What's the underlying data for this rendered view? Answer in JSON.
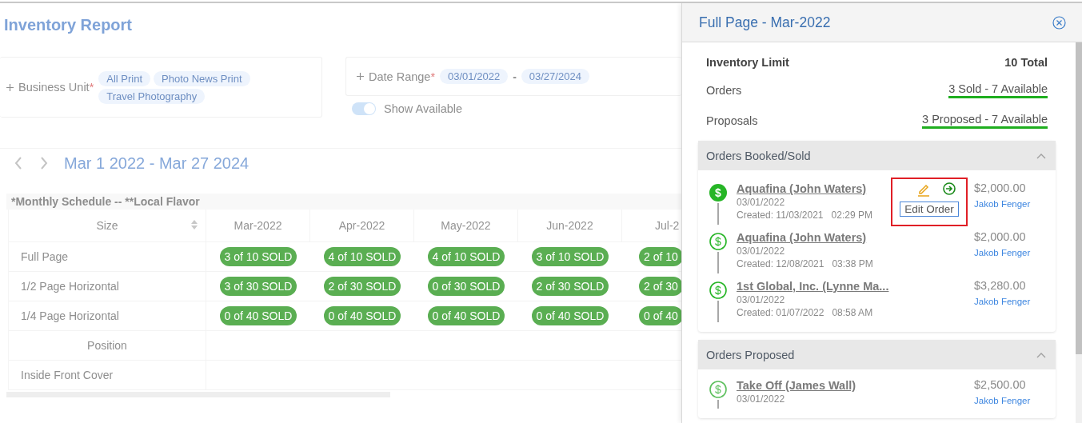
{
  "report": {
    "title": "Inventory Report",
    "business_unit": {
      "label": "Business Unit",
      "required_mark": "*",
      "chips": [
        "All Print",
        "Photo News Print",
        "Travel Photography"
      ]
    },
    "date_range": {
      "label": "Date Range",
      "required_mark": "*",
      "start": "03/01/2022",
      "separator": "-",
      "end": "03/27/2024"
    },
    "show_available": {
      "label": "Show Available",
      "on": true
    },
    "period": "Mar 1 2022 - Mar 27 2024",
    "schedule_title": "*Monthly Schedule -- **Local Flavor",
    "table": {
      "columns": [
        "Size",
        "Mar-2022",
        "Apr-2022",
        "May-2022",
        "Jun-2022",
        "Jul-2"
      ],
      "rows": [
        {
          "kind": "item",
          "cells": [
            "Full Page",
            "3 of 10 SOLD",
            "4 of 10 SOLD",
            "4 of 10 SOLD",
            "3 of 10 SOLD",
            "2 of 10"
          ]
        },
        {
          "kind": "item",
          "cells": [
            "1/2 Page Horizontal",
            "3 of 30 SOLD",
            "2 of 30 SOLD",
            "0 of 30 SOLD",
            "2 of 30 SOLD",
            "2 of 30"
          ]
        },
        {
          "kind": "item",
          "cells": [
            "1/4 Page Horizontal",
            "0 of 40 SOLD",
            "0 of 40 SOLD",
            "0 of 40 SOLD",
            "0 of 40 SOLD",
            "0 of 40"
          ]
        },
        {
          "kind": "group",
          "cells": [
            "Position"
          ]
        },
        {
          "kind": "item",
          "cells": [
            "Inside Front Cover"
          ]
        }
      ]
    }
  },
  "panel": {
    "title": "Full Page - Mar-2022",
    "summary": [
      {
        "kind": "total",
        "label": "Inventory Limit",
        "value": "10 Total"
      },
      {
        "kind": "link",
        "label": "Orders",
        "value": "3 Sold - 7 Available"
      },
      {
        "kind": "link",
        "label": "Proposals",
        "value": "3 Proposed - 7 Available"
      }
    ],
    "sections": [
      {
        "title": "Orders Booked/Sold",
        "expanded": true,
        "orders": [
          {
            "symbol": "$",
            "name": "Aquafina (John Waters)",
            "date": "03/01/2022",
            "created": "Created: 11/03/2021   02:29 PM",
            "amount": "$2,000.00",
            "rep": "Jakob Fenger",
            "active": true,
            "tooltip": "Edit Order",
            "highlighted": true
          },
          {
            "symbol": "$",
            "name": "Aquafina (John Waters)",
            "date": "03/01/2022",
            "created": "Created: 12/08/2021   03:38 PM",
            "amount": "$2,000.00",
            "rep": "Jakob Fenger",
            "active": false,
            "highlighted": false
          },
          {
            "symbol": "$",
            "name": "1st Global, Inc. (Lynne Ma...",
            "date": "03/01/2022",
            "created": "Created: 01/07/2022   08:58 AM",
            "amount": "$3,280.00",
            "rep": "Jakob Fenger",
            "active": false,
            "highlighted": false
          }
        ]
      },
      {
        "title": "Orders Proposed",
        "expanded": true,
        "orders": [
          {
            "symbol": "$",
            "name": "Take Off (James Wall)",
            "date": "03/01/2022",
            "amount": "$2,500.00",
            "rep": "Jakob Fenger",
            "active": false,
            "proposed": true,
            "highlighted": false
          }
        ]
      }
    ]
  }
}
